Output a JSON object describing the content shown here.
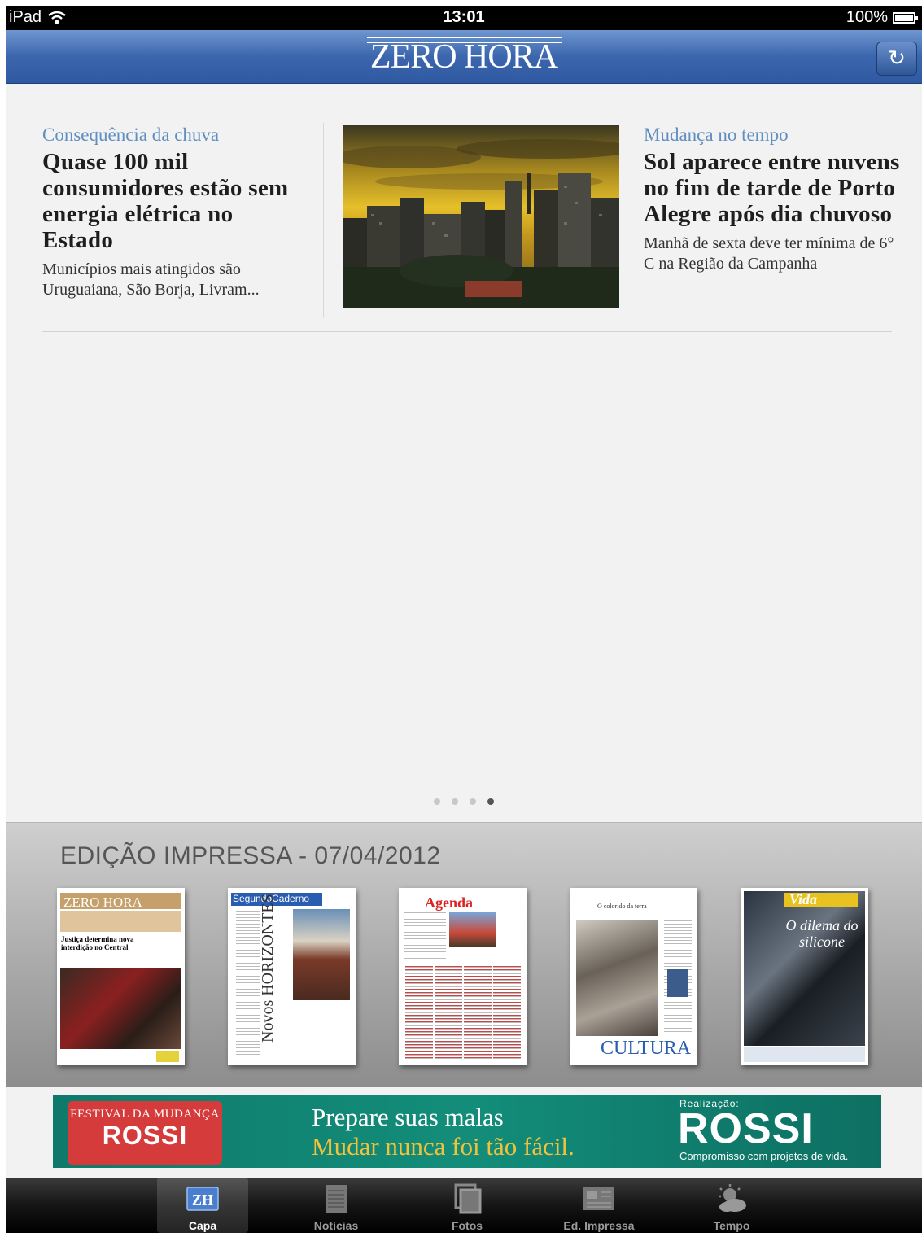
{
  "status_bar": {
    "device": "iPad",
    "time": "13:01",
    "battery": "100%"
  },
  "nav": {
    "logo": "ZERO HORA",
    "refresh_icon": "refresh-icon"
  },
  "stories": [
    {
      "kicker": "Consequência da chuva",
      "headline": "Quase 100 mil consumidores estão sem energia elétrica no Estado",
      "summary": "Municípios mais atingidos são Uruguaiana, São Borja, Livram..."
    },
    {
      "kicker": "Mudança no tempo",
      "headline": "Sol aparece entre nuvens no fim de tarde de Porto Alegre após dia chuvoso",
      "summary": "Manhã de sexta deve ter mínima de 6° C na Região da Campanha"
    }
  ],
  "pager": {
    "pages": 4,
    "active": 4
  },
  "edition": {
    "title": "EDIÇÃO IMPRESSA - 07/04/2012",
    "thumbs": [
      {
        "name": "ZERO HORA",
        "text": "Justiça determina nova interdição no Central"
      },
      {
        "name": "SegundoCaderno",
        "text": "Novos HORIZONTES"
      },
      {
        "name": "Agenda",
        "text": ""
      },
      {
        "name": "O colorido da terra",
        "text": "CULTURA"
      },
      {
        "name": "Vida",
        "text": "O dilema do silicone"
      }
    ]
  },
  "banner": {
    "festival_top": "FESTIVAL DA MUDANÇA",
    "festival_brand": "ROSSI",
    "line1": "Prepare suas malas",
    "line2": "Mudar nunca foi tão fácil.",
    "realizacao": "Realização:",
    "brand": "ROSSI",
    "tagline": "Compromisso com projetos de vida."
  },
  "tabs": [
    {
      "label": "Capa",
      "icon": "zh-icon",
      "active": true
    },
    {
      "label": "Notícias",
      "icon": "newspaper-icon",
      "active": false
    },
    {
      "label": "Fotos",
      "icon": "photos-icon",
      "active": false
    },
    {
      "label": "Ed. Impressa",
      "icon": "print-edition-icon",
      "active": false
    },
    {
      "label": "Tempo",
      "icon": "weather-icon",
      "active": false
    }
  ],
  "colors": {
    "nav": "#3b66ad",
    "kicker": "#5f8ec0",
    "banner": "#138d7a",
    "banner_accent": "#f2c23a"
  }
}
